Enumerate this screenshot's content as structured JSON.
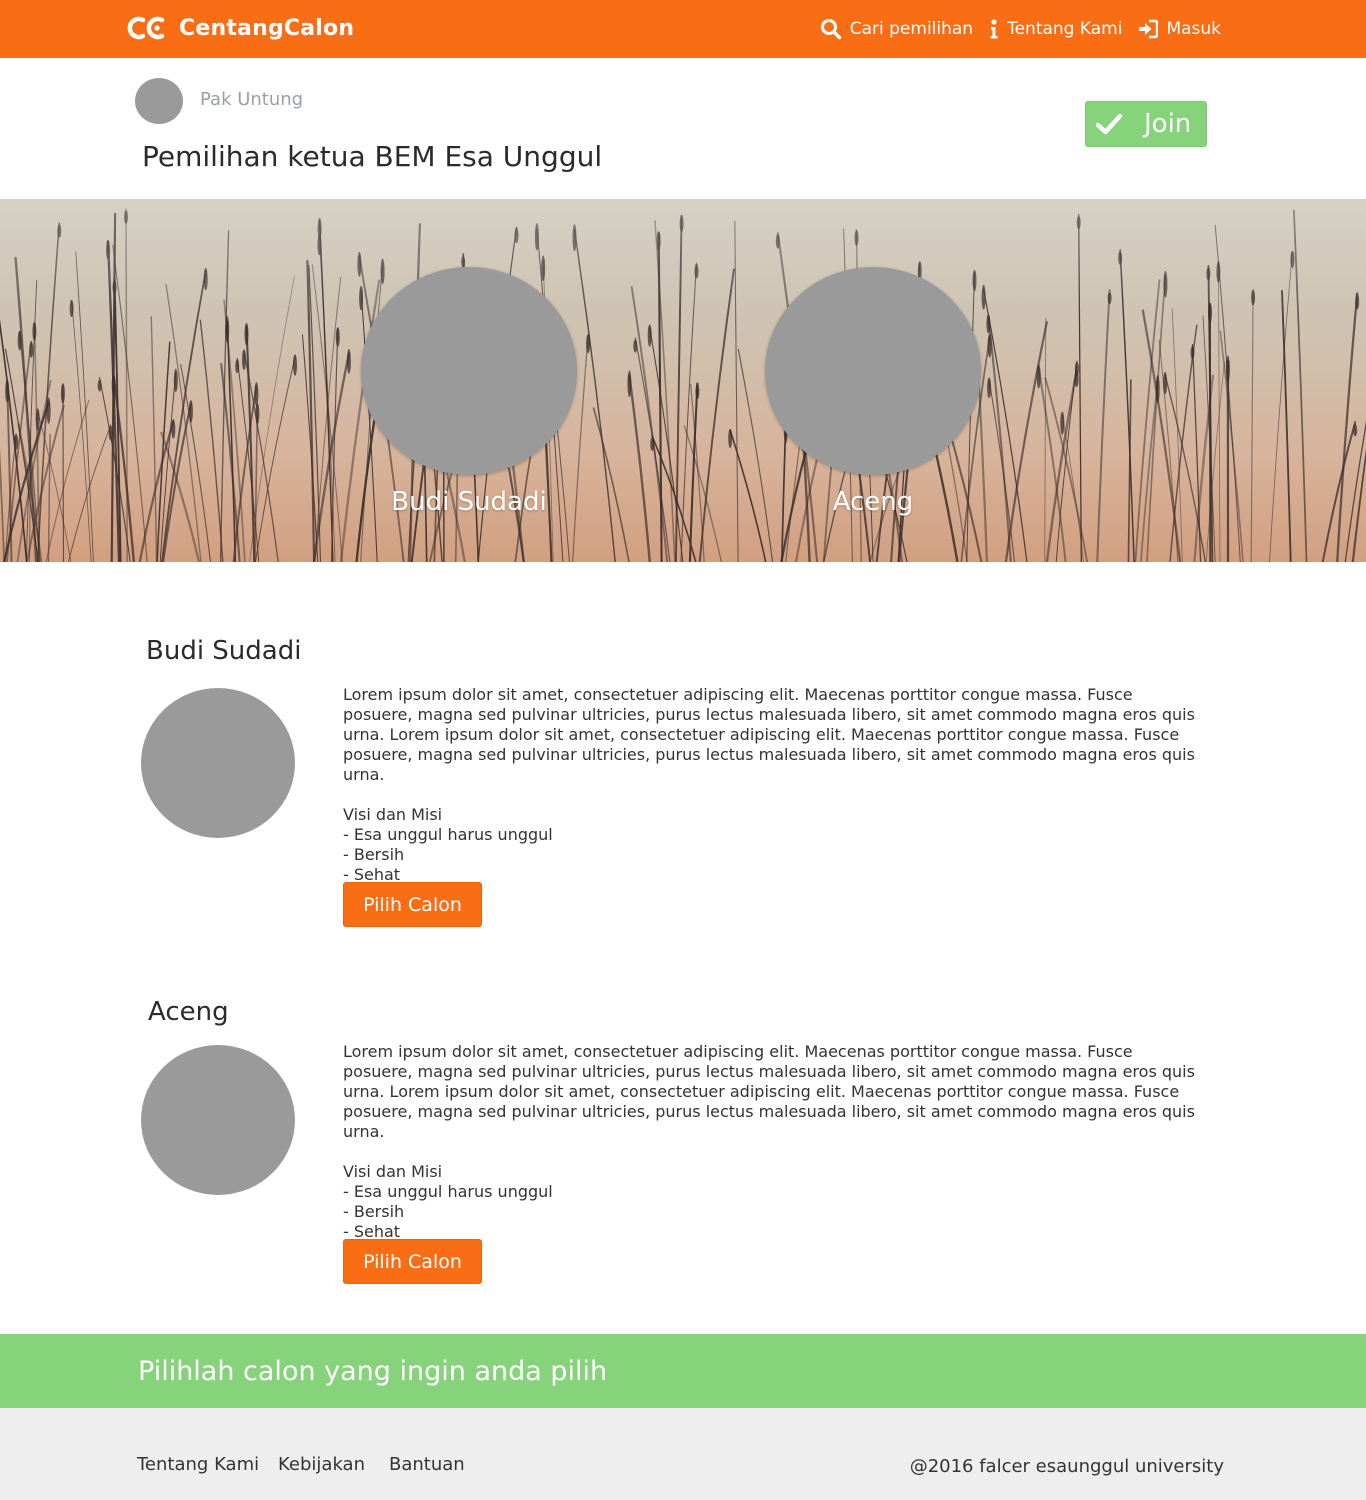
{
  "navbar": {
    "brand": "CentangCalon",
    "items": [
      {
        "label": "Cari pemilihan",
        "icon": "search-icon"
      },
      {
        "label": "Tentang Kami",
        "icon": "info-icon"
      },
      {
        "label": "Masuk",
        "icon": "sign-in-icon"
      }
    ]
  },
  "header": {
    "owner": "Pak Untung",
    "title": "Pemilihan ketua BEM Esa Unggul",
    "join_label": "Join"
  },
  "hero": {
    "candidates": [
      "Budi Sudadi",
      "Aceng"
    ]
  },
  "candidates": [
    {
      "name": "Budi Sudadi",
      "description": "Lorem ipsum dolor sit amet, consectetuer adipiscing elit. Maecenas porttitor congue massa. Fusce posuere, magna sed pulvinar ultricies, purus lectus malesuada libero, sit amet commodo magna eros quis urna. Lorem ipsum dolor sit amet, consectetuer adipiscing elit. Maecenas porttitor congue massa. Fusce posuere, magna sed pulvinar ultricies, purus lectus malesuada libero, sit amet commodo magna eros quis urna.",
      "vision_title": "Visi dan Misi",
      "vision_items": [
        "- Esa unggul harus unggul",
        "- Bersih",
        "- Sehat"
      ],
      "button_label": "Pilih Calon"
    },
    {
      "name": "Aceng",
      "description": "Lorem ipsum dolor sit amet, consectetuer adipiscing elit. Maecenas porttitor congue massa. Fusce posuere, magna sed pulvinar ultricies, purus lectus malesuada libero, sit amet commodo magna eros quis urna. Lorem ipsum dolor sit amet, consectetuer adipiscing elit. Maecenas porttitor congue massa. Fusce posuere, magna sed pulvinar ultricies, purus lectus malesuada libero, sit amet commodo magna eros quis urna.",
      "vision_title": "Visi dan Misi",
      "vision_items": [
        "- Esa unggul harus unggul",
        "- Bersih",
        "- Sehat"
      ],
      "button_label": "Pilih Calon"
    }
  ],
  "banner": {
    "text": "Pilihlah calon yang ingin anda pilih"
  },
  "footer": {
    "links": [
      "Tentang Kami",
      "Kebijakan",
      "Bantuan"
    ],
    "copyright": "@2016 falcer esaunggul university"
  },
  "colors": {
    "primary": "#f96d15",
    "success": "#87d37c",
    "avatar": "#9a9a9a",
    "footer_bg": "#eeeeee"
  }
}
